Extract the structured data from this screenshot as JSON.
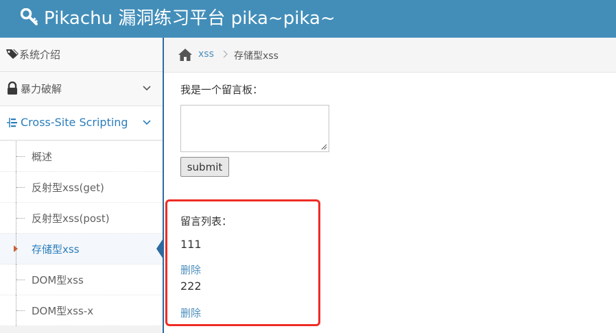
{
  "header": {
    "title": "Pikachu 漏洞练习平台 pika~pika~",
    "icon": "key-icon"
  },
  "sidebar": {
    "items": [
      {
        "label": "系统介绍",
        "icon": "tags-icon"
      },
      {
        "label": "暴力破解",
        "icon": "lock-icon"
      },
      {
        "label": "Cross-Site Scripting",
        "icon": "list-tree-icon"
      }
    ],
    "submenu": [
      {
        "label": "概述"
      },
      {
        "label": "反射型xss(get)"
      },
      {
        "label": "反射型xss(post)"
      },
      {
        "label": "存储型xss"
      },
      {
        "label": "DOM型xss"
      },
      {
        "label": "DOM型xss-x"
      }
    ]
  },
  "breadcrumb": {
    "link": "xss",
    "current": "存储型xss"
  },
  "form": {
    "label": "我是一个留言板：",
    "textarea_value": "",
    "submit_label": "submit"
  },
  "messages": {
    "heading": "留言列表：",
    "items": [
      {
        "text": "111",
        "delete_label": "删除"
      },
      {
        "text": "222",
        "delete_label": "删除"
      }
    ]
  },
  "colors": {
    "header_bg": "#438eb9",
    "accent": "#2b7dbc",
    "highlight_border": "#ef2b25"
  }
}
